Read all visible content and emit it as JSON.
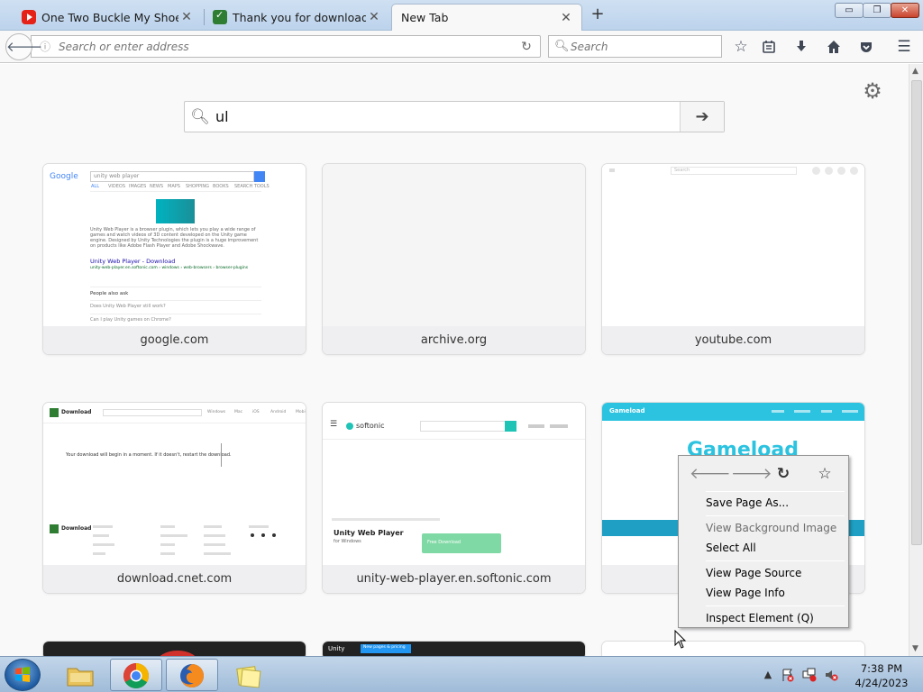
{
  "tabs": [
    {
      "title": "One Two Buckle My Shoe ...",
      "icon": "youtube-icon"
    },
    {
      "title": "Thank you for downloadin...",
      "icon": "cnet-download-icon"
    },
    {
      "title": "New Tab",
      "icon": "none"
    }
  ],
  "window": {
    "minimize": "▭",
    "restore": "❐",
    "close": "✕"
  },
  "toolbar": {
    "url_placeholder": "Search or enter address",
    "search_placeholder": "Search"
  },
  "newtab": {
    "search_value": "ul"
  },
  "tiles": [
    {
      "label": "google.com"
    },
    {
      "label": "archive.org"
    },
    {
      "label": "youtube.com"
    },
    {
      "label": "download.cnet.com"
    },
    {
      "label": "unity-web-player.en.softonic.com"
    },
    {
      "label": ""
    }
  ],
  "thumbs": {
    "google": {
      "logo": "Google",
      "query": "unity web player",
      "snippet": "Unity Web Player is a browser plugin, which lets you play a wide range of games and watch videos of 3D content developed on the Unity game engine. Designed by Unity Technologies the plugin is a huge improvement on products like Adobe Flash Player and Adobe Shockwave.",
      "link": "Unity Web Player - Download",
      "url": "unity-web-player.en.softonic.com › windows › web-browsers › browser-plugins",
      "people": "People also ask",
      "q1": "Does Unity Web Player still work?",
      "q2": "Can I play Unity games on Chrome?",
      "tabs": [
        "ALL",
        "VIDEOS",
        "IMAGES",
        "NEWS",
        "MAPS",
        "SHOPPING",
        "BOOKS",
        "SEARCH TOOLS"
      ]
    },
    "youtube": {
      "search": "Search"
    },
    "cnet": {
      "brand": "Download",
      "msg": "Your download will begin in a moment. If it doesn't, restart the download.",
      "nav": [
        "Windows",
        "Mac",
        "iOS",
        "Android",
        "Mobi"
      ]
    },
    "softonic": {
      "brand": "softonic",
      "title": "Unity Web Player",
      "sub": "for Windows",
      "btn": "Free Download"
    },
    "gameload": {
      "brand": "Gameload",
      "big": "Gameload"
    },
    "unity": {
      "brand": "Unity",
      "btn": "New pages & pricing"
    }
  },
  "context_menu": {
    "items": [
      {
        "label": "Save Page As...",
        "disabled": false
      },
      {
        "label": "View Background Image",
        "disabled": true
      },
      {
        "label": "Select All",
        "disabled": false
      },
      {
        "label": "View Page Source",
        "disabled": false
      },
      {
        "label": "View Page Info",
        "disabled": false
      },
      {
        "label": "Inspect Element (Q)",
        "disabled": false
      }
    ]
  },
  "taskbar": {
    "apps": [
      "windows-explorer",
      "google-chrome",
      "firefox",
      "sticky-notes"
    ],
    "time": "7:38 PM",
    "date": "4/24/2023"
  },
  "colors": {
    "accent": "#0a84ff",
    "titlebar": "#bcd3ec",
    "close": "#c9432c"
  }
}
